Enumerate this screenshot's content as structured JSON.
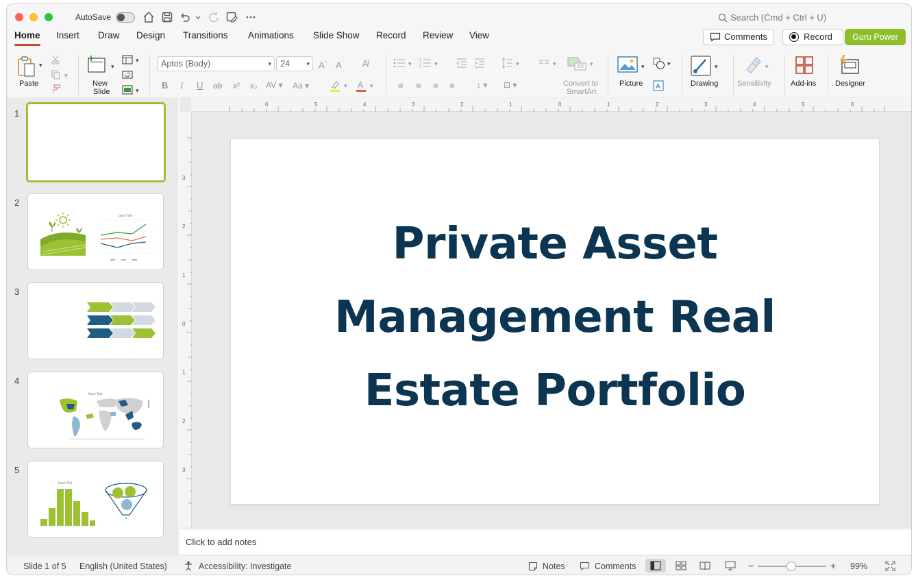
{
  "titlebar": {
    "autosave_label": "AutoSave",
    "search_placeholder": "Search (Cmd + Ctrl + U)"
  },
  "tabs": [
    "Home",
    "Insert",
    "Draw",
    "Design",
    "Transitions",
    "Animations",
    "Slide Show",
    "Record",
    "Review",
    "View"
  ],
  "header_buttons": {
    "comments": "Comments",
    "record": "Record",
    "guru": "Guru Power"
  },
  "ribbon": {
    "paste": "Paste",
    "new_slide_line1": "New",
    "new_slide_line2": "Slide",
    "font_name": "Aptos (Body)",
    "font_size": "24",
    "convert_line1": "Convert to",
    "convert_line2": "SmartArt",
    "picture": "Picture",
    "drawing": "Drawing",
    "sensitivity": "Sensitivity",
    "addins": "Add-ins",
    "designer": "Designer"
  },
  "thumbnails": {
    "numbers": [
      "1",
      "2",
      "3",
      "4",
      "5"
    ],
    "chart_title": "Chart Title"
  },
  "ruler": {
    "h": [
      "6",
      "5",
      "4",
      "3",
      "2",
      "1",
      "0",
      "1",
      "2",
      "3",
      "4",
      "5",
      "6"
    ],
    "v": [
      "3",
      "2",
      "1",
      "0",
      "1",
      "2",
      "3"
    ]
  },
  "slide": {
    "title_line1": "Private Asset",
    "title_line2": "Management Real",
    "title_line3": "Estate Portfolio"
  },
  "notes": {
    "placeholder": "Click to add notes"
  },
  "status": {
    "slide_count": "Slide 1 of 5",
    "language": "English (United States)",
    "accessibility": "Accessibility: Investigate",
    "notes": "Notes",
    "comments": "Comments",
    "zoom": "99%"
  },
  "colors": {
    "accent": "#c04b2e",
    "title": "#0b3550",
    "green": "#8ebf2b",
    "blue": "#1f5e80"
  }
}
